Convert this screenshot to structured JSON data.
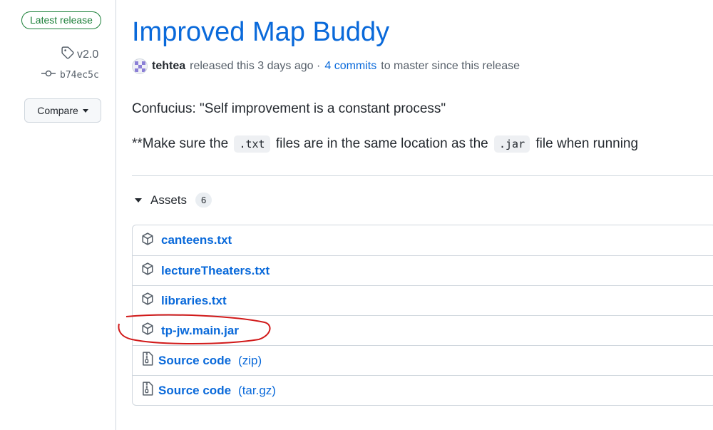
{
  "sidebar": {
    "latest_badge": "Latest release",
    "tag": "v2.0",
    "commit": "b74ec5c",
    "compare_label": "Compare"
  },
  "release": {
    "title": "Improved Map Buddy",
    "author": "tehtea",
    "released_text": "released this 3 days ago ·",
    "commits_link": "4 commits",
    "commits_suffix": "to master since this release"
  },
  "body": {
    "quote": "Confucius: \"Self improvement is a constant process\"",
    "note_prefix": "**Make sure the",
    "note_code1": ".txt",
    "note_middle": "files are in the same location as the",
    "note_code2": ".jar",
    "note_suffix": "file when running"
  },
  "assets": {
    "label": "Assets",
    "count": "6",
    "items": [
      {
        "name": "canteens.txt",
        "ext": "",
        "icon": "package-icon"
      },
      {
        "name": "lectureTheaters.txt",
        "ext": "",
        "icon": "package-icon"
      },
      {
        "name": "libraries.txt",
        "ext": "",
        "icon": "package-icon"
      },
      {
        "name": "tp-jw.main.jar",
        "ext": "",
        "icon": "package-icon"
      },
      {
        "name": "Source code",
        "ext": "(zip)",
        "icon": "file-zip-icon"
      },
      {
        "name": "Source code",
        "ext": "(tar.gz)",
        "icon": "file-zip-icon"
      }
    ]
  },
  "colors": {
    "link": "#0969da",
    "success": "#1a7f37",
    "annotation": "#d11a1a"
  }
}
